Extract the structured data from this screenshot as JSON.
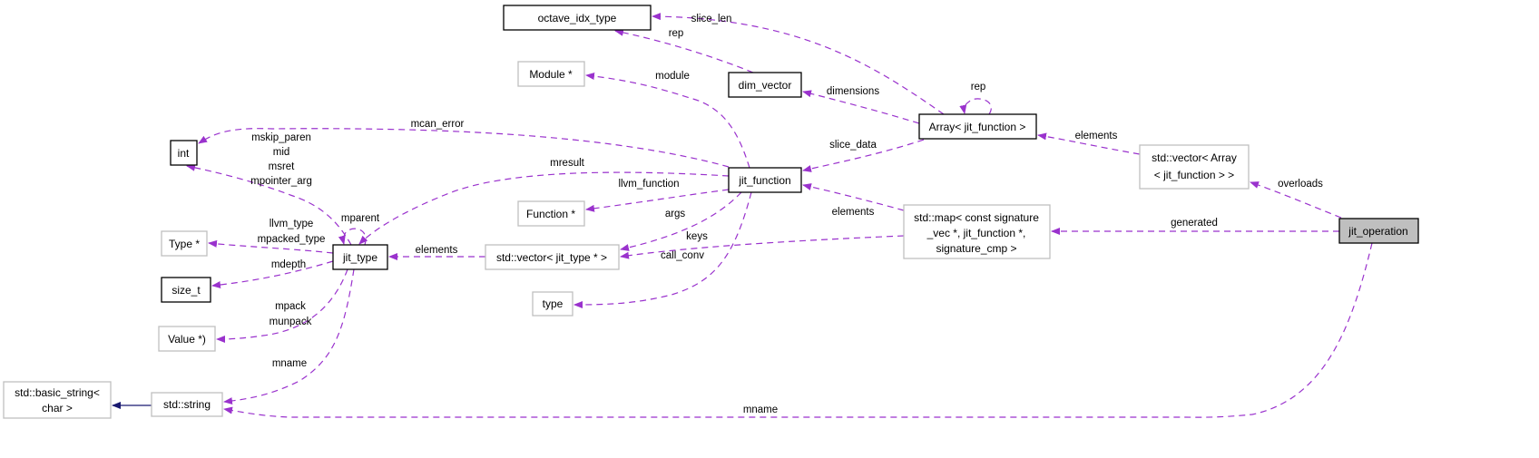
{
  "colors": {
    "usage_edge": "#9a32cd",
    "inheritance_edge": "#191970",
    "documented_border": "#000000",
    "undocumented_border": "#bfbfbf",
    "current_fill": "#bfbfbf"
  },
  "nodes": {
    "octave_idx_type": "octave_idx_type",
    "module_ptr": "Module *",
    "dim_vector": "dim_vector",
    "array": "Array< jit_function >",
    "int": "int",
    "jit_function": "jit_function",
    "vector_array": [
      "std::vector< Array",
      "< jit_function > >"
    ],
    "function_ptr": "Function *",
    "type_ptr": "Type *",
    "jit_type": "jit_type",
    "vector_jit_type": "std::vector< jit_type * >",
    "map": [
      "std::map< const signature",
      "_vec *, jit_function *,",
      "signature_cmp >"
    ],
    "jit_operation": "jit_operation",
    "size_t": "size_t",
    "type": "type",
    "value_ptr": "Value *)",
    "basic_string": [
      "std::basic_string<",
      "char >"
    ],
    "std_string": "std::string"
  },
  "edges": {
    "slice_len": "slice_len",
    "rep_dim": "rep",
    "dimensions": "dimensions",
    "rep_array": "rep",
    "module": "module",
    "mcan_error": "mcan_error",
    "slice_data": "slice_data",
    "elements_array": "elements",
    "mresult": "mresult",
    "llvm_function": "llvm_function",
    "args": "args",
    "call_conv": "call_conv",
    "elements_map": "elements",
    "keys": "keys",
    "elements_vec": "elements",
    "int_labels": [
      "mskip_paren",
      "mid",
      "msret",
      "mpointer_arg"
    ],
    "mparent": "mparent",
    "type_labels": [
      "llvm_type",
      "mpacked_type"
    ],
    "mdepth": "mdepth",
    "value_labels": [
      "mpack",
      "munpack"
    ],
    "mname_jit_type": "mname",
    "mname_op": "mname",
    "generated": "generated",
    "overloads": "overloads"
  }
}
